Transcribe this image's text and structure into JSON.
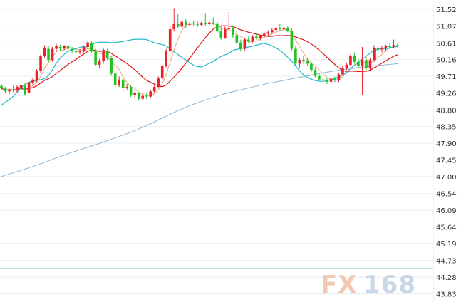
{
  "logo": {
    "fx": "FX",
    "num": "168"
  },
  "chart_data": {
    "type": "candlestick",
    "title": "",
    "xlabel": "",
    "ylabel": "",
    "ylim": [
      43.8,
      51.75
    ],
    "yticks": [
      "51.52",
      "51.07",
      "50.61",
      "50.16",
      "49.71",
      "49.26",
      "48.80",
      "48.35",
      "47.90",
      "47.45",
      "47.00",
      "46.54",
      "46.09",
      "45.64",
      "45.19",
      "44.73",
      "44.28",
      "43.83"
    ],
    "grid": true,
    "colors": {
      "up": "#e8212b",
      "down": "#21c321",
      "ma_tan": "#e6a97c",
      "ma_cyan": "#25b8c8",
      "ma_red": "#e0151b",
      "ma_blue": "#8fb7d6",
      "grid": "#e8eef3",
      "cursor_line": "#7fc6cf"
    },
    "candles": [
      [
        49.45,
        49.5,
        49.32,
        49.38
      ],
      [
        49.38,
        49.42,
        49.25,
        49.3
      ],
      [
        49.3,
        49.4,
        49.22,
        49.35
      ],
      [
        49.35,
        49.45,
        49.28,
        49.32
      ],
      [
        49.32,
        49.48,
        49.26,
        49.42
      ],
      [
        49.4,
        49.55,
        49.33,
        49.48
      ],
      [
        49.46,
        49.52,
        49.18,
        49.22
      ],
      [
        49.25,
        49.6,
        49.2,
        49.55
      ],
      [
        49.52,
        49.68,
        49.45,
        49.62
      ],
      [
        49.6,
        49.9,
        49.55,
        49.85
      ],
      [
        49.85,
        50.3,
        49.8,
        50.25
      ],
      [
        50.25,
        50.55,
        50.2,
        50.48
      ],
      [
        50.45,
        50.52,
        50.1,
        50.15
      ],
      [
        50.15,
        50.5,
        50.1,
        50.45
      ],
      [
        50.45,
        50.58,
        50.38,
        50.52
      ],
      [
        50.5,
        50.56,
        50.4,
        50.46
      ],
      [
        50.46,
        50.55,
        50.42,
        50.52
      ],
      [
        50.52,
        50.55,
        50.42,
        50.45
      ],
      [
        50.45,
        50.5,
        50.35,
        50.4
      ],
      [
        50.4,
        50.48,
        50.32,
        50.36
      ],
      [
        50.36,
        50.44,
        50.3,
        50.38
      ],
      [
        50.38,
        50.55,
        50.35,
        50.5
      ],
      [
        50.5,
        50.68,
        50.45,
        50.62
      ],
      [
        50.6,
        50.65,
        50.35,
        50.38
      ],
      [
        50.38,
        50.45,
        49.98,
        50.02
      ],
      [
        50.02,
        50.18,
        49.92,
        50.12
      ],
      [
        50.12,
        50.48,
        50.05,
        50.42
      ],
      [
        50.4,
        50.45,
        50.15,
        50.2
      ],
      [
        50.2,
        50.25,
        49.72,
        49.78
      ],
      [
        49.78,
        49.85,
        49.4,
        49.48
      ],
      [
        49.48,
        49.7,
        49.42,
        49.62
      ],
      [
        49.62,
        49.68,
        49.3,
        49.4
      ],
      [
        49.4,
        49.5,
        49.35,
        49.42
      ],
      [
        49.42,
        49.48,
        49.15,
        49.2
      ],
      [
        49.2,
        49.3,
        49.12,
        49.25
      ],
      [
        49.25,
        49.28,
        49.05,
        49.1
      ],
      [
        49.1,
        49.22,
        49.06,
        49.18
      ],
      [
        49.18,
        49.25,
        49.1,
        49.16
      ],
      [
        49.16,
        49.35,
        49.12,
        49.3
      ],
      [
        49.3,
        49.48,
        49.25,
        49.42
      ],
      [
        49.42,
        49.7,
        49.38,
        49.65
      ],
      [
        49.65,
        50.05,
        49.6,
        50.0
      ],
      [
        50.0,
        50.45,
        49.95,
        50.4
      ],
      [
        50.4,
        51.05,
        50.35,
        50.98
      ],
      [
        50.98,
        51.55,
        50.92,
        51.12
      ],
      [
        51.12,
        51.4,
        51.0,
        51.05
      ],
      [
        51.05,
        51.22,
        51.0,
        51.18
      ],
      [
        51.18,
        51.25,
        51.02,
        51.1
      ],
      [
        51.1,
        51.2,
        51.05,
        51.14
      ],
      [
        51.14,
        51.22,
        51.08,
        51.12
      ],
      [
        51.12,
        51.2,
        51.04,
        51.1
      ],
      [
        51.1,
        51.18,
        51.06,
        51.15
      ],
      [
        51.15,
        51.42,
        51.08,
        51.12
      ],
      [
        51.12,
        51.2,
        51.05,
        51.16
      ],
      [
        51.16,
        51.3,
        51.1,
        51.14
      ],
      [
        51.14,
        51.2,
        50.85,
        50.92
      ],
      [
        50.92,
        51.05,
        50.7,
        50.75
      ],
      [
        50.75,
        51.05,
        50.72,
        50.98
      ],
      [
        50.98,
        51.45,
        50.95,
        51.02
      ],
      [
        51.02,
        51.08,
        50.75,
        50.82
      ],
      [
        50.82,
        50.92,
        50.55,
        50.62
      ],
      [
        50.62,
        50.7,
        50.38,
        50.45
      ],
      [
        50.45,
        50.75,
        50.4,
        50.7
      ],
      [
        50.7,
        50.78,
        50.6,
        50.65
      ],
      [
        50.65,
        50.82,
        50.6,
        50.78
      ],
      [
        50.78,
        50.85,
        50.7,
        50.74
      ],
      [
        50.74,
        50.82,
        50.68,
        50.8
      ],
      [
        50.8,
        50.9,
        50.75,
        50.86
      ],
      [
        50.86,
        50.95,
        50.8,
        50.9
      ],
      [
        50.9,
        51.02,
        50.85,
        50.96
      ],
      [
        50.96,
        51.05,
        50.9,
        51.0
      ],
      [
        51.0,
        51.12,
        50.94,
        50.98
      ],
      [
        50.98,
        51.05,
        50.92,
        51.02
      ],
      [
        51.02,
        51.06,
        50.9,
        50.94
      ],
      [
        50.94,
        51.0,
        50.4,
        50.45
      ],
      [
        50.45,
        50.52,
        50.0,
        50.05
      ],
      [
        50.05,
        50.2,
        49.95,
        50.15
      ],
      [
        50.15,
        50.25,
        50.05,
        50.12
      ],
      [
        50.12,
        50.2,
        49.98,
        50.05
      ],
      [
        50.05,
        50.1,
        49.82,
        49.88
      ],
      [
        49.88,
        49.95,
        49.68,
        49.72
      ],
      [
        49.72,
        49.78,
        49.58,
        49.62
      ],
      [
        49.62,
        49.7,
        49.52,
        49.6
      ],
      [
        49.6,
        49.65,
        49.5,
        49.56
      ],
      [
        49.56,
        49.68,
        49.52,
        49.64
      ],
      [
        49.64,
        49.7,
        49.55,
        49.6
      ],
      [
        49.6,
        49.8,
        49.55,
        49.76
      ],
      [
        49.76,
        49.98,
        49.72,
        49.92
      ],
      [
        49.92,
        50.08,
        49.88,
        50.02
      ],
      [
        50.02,
        50.3,
        49.98,
        50.25
      ],
      [
        50.25,
        50.35,
        50.05,
        50.1
      ],
      [
        50.1,
        50.18,
        49.92,
        49.98
      ],
      [
        49.98,
        50.5,
        49.2,
        50.15
      ],
      [
        50.15,
        50.22,
        49.85,
        49.92
      ],
      [
        49.92,
        50.2,
        49.88,
        50.15
      ],
      [
        50.15,
        50.55,
        50.1,
        50.48
      ],
      [
        50.48,
        50.56,
        50.38,
        50.44
      ],
      [
        50.44,
        50.52,
        50.36,
        50.48
      ],
      [
        50.48,
        50.56,
        50.4,
        50.52
      ],
      [
        50.52,
        50.6,
        50.44,
        50.5
      ],
      [
        50.5,
        50.7,
        50.46,
        50.55
      ],
      [
        50.55,
        50.6,
        50.48,
        50.54
      ]
    ],
    "moving_averages": [
      {
        "period": 5,
        "color_key": "ma_tan"
      },
      {
        "period": 10,
        "color_key": "ma_cyan"
      },
      {
        "period": 30,
        "color_key": "ma_red"
      },
      {
        "period": 120,
        "color_key": "ma_blue"
      }
    ],
    "ma_blue_values": [
      [
        0,
        47.0
      ],
      [
        10,
        47.16
      ],
      [
        20,
        47.33
      ],
      [
        30,
        47.52
      ],
      [
        40,
        47.7
      ],
      [
        50,
        47.86
      ],
      [
        60,
        48.04
      ],
      [
        70,
        48.22
      ],
      [
        80,
        48.45
      ],
      [
        90,
        48.7
      ],
      [
        100,
        48.92
      ],
      [
        110,
        49.1
      ],
      [
        120,
        49.26
      ],
      [
        130,
        49.38
      ],
      [
        140,
        49.5
      ],
      [
        150,
        49.6
      ],
      [
        160,
        49.7
      ],
      [
        170,
        49.8
      ],
      [
        180,
        49.88
      ],
      [
        190,
        49.95
      ],
      [
        200,
        50.0
      ],
      [
        210,
        50.05
      ]
    ],
    "ma_cyan_values": [
      [
        0,
        48.93
      ],
      [
        10,
        49.0
      ],
      [
        20,
        49.07
      ],
      [
        30,
        49.14
      ],
      [
        40,
        49.24
      ],
      [
        50,
        49.35
      ],
      [
        60,
        49.44
      ],
      [
        70,
        49.52
      ],
      [
        80,
        49.56
      ],
      [
        90,
        49.58
      ],
      [
        100,
        49.6
      ],
      [
        110,
        49.62
      ],
      [
        120,
        49.65
      ],
      [
        130,
        49.73
      ],
      [
        140,
        49.88
      ],
      [
        150,
        50.05
      ],
      [
        160,
        50.18
      ],
      [
        170,
        50.28
      ],
      [
        180,
        50.36
      ],
      [
        190,
        50.42
      ],
      [
        200,
        50.44
      ],
      [
        210,
        50.47
      ],
      [
        220,
        50.5
      ],
      [
        230,
        50.5
      ],
      [
        240,
        50.52
      ],
      [
        250,
        50.57
      ],
      [
        260,
        50.62
      ],
      [
        270,
        50.63
      ],
      [
        280,
        50.63
      ],
      [
        290,
        50.63
      ],
      [
        300,
        50.62
      ],
      [
        310,
        50.62
      ],
      [
        320,
        50.63
      ],
      [
        330,
        50.64
      ],
      [
        340,
        50.66
      ],
      [
        350,
        50.68
      ],
      [
        360,
        50.7
      ],
      [
        370,
        50.71
      ],
      [
        380,
        50.71
      ],
      [
        390,
        50.71
      ],
      [
        400,
        50.7
      ],
      [
        410,
        50.66
      ],
      [
        420,
        50.62
      ],
      [
        430,
        50.59
      ],
      [
        440,
        50.57
      ],
      [
        450,
        50.55
      ],
      [
        460,
        50.48
      ],
      [
        470,
        50.41
      ],
      [
        480,
        50.34
      ],
      [
        490,
        50.27
      ],
      [
        500,
        50.2
      ],
      [
        510,
        50.13
      ],
      [
        520,
        50.06
      ],
      [
        530,
        50.0
      ],
      [
        540,
        49.97
      ],
      [
        550,
        49.96
      ],
      [
        560,
        50.0
      ],
      [
        570,
        50.05
      ],
      [
        580,
        50.1
      ],
      [
        590,
        50.16
      ],
      [
        600,
        50.22
      ],
      [
        610,
        50.27
      ],
      [
        620,
        50.31
      ],
      [
        630,
        50.36
      ],
      [
        640,
        50.42
      ],
      [
        650,
        50.44
      ],
      [
        660,
        50.46
      ],
      [
        670,
        50.48
      ],
      [
        680,
        50.5
      ],
      [
        690,
        50.52
      ],
      [
        700,
        50.55
      ],
      [
        710,
        50.57
      ],
      [
        720,
        50.6
      ],
      [
        730,
        50.58
      ],
      [
        740,
        50.55
      ],
      [
        750,
        50.5
      ],
      [
        760,
        50.45
      ],
      [
        770,
        50.38
      ],
      [
        780,
        50.3
      ],
      [
        790,
        50.2
      ],
      [
        800,
        50.1
      ],
      [
        810,
        49.98
      ],
      [
        820,
        49.86
      ],
      [
        830,
        49.76
      ],
      [
        840,
        49.69
      ],
      [
        850,
        49.64
      ],
      [
        860,
        49.6
      ],
      [
        870,
        49.58
      ],
      [
        880,
        49.57
      ],
      [
        890,
        49.58
      ],
      [
        900,
        49.6
      ],
      [
        910,
        49.63
      ],
      [
        920,
        49.66
      ],
      [
        930,
        49.7
      ],
      [
        940,
        49.75
      ],
      [
        950,
        49.82
      ],
      [
        960,
        49.91
      ],
      [
        970,
        50.0
      ],
      [
        980,
        50.08
      ],
      [
        990,
        50.16
      ],
      [
        1000,
        50.22
      ],
      [
        1010,
        50.3
      ],
      [
        1020,
        50.38
      ],
      [
        1030,
        50.42
      ],
      [
        1040,
        50.44
      ],
      [
        1050,
        50.45
      ],
      [
        1060,
        50.46
      ],
      [
        1070,
        50.48
      ],
      [
        1080,
        50.5
      ],
      [
        1090,
        50.52
      ]
    ]
  }
}
